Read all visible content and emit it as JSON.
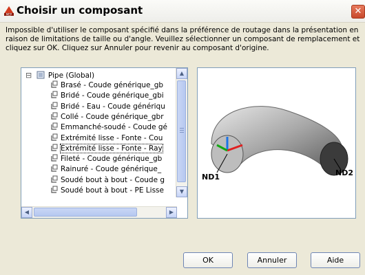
{
  "dialog": {
    "title": "Choisir un composant",
    "close_glyph": "✕",
    "message": "Impossible d'utiliser le composant spécifié dans la préférence de routage dans la présentation en raison de limitations de taille ou d'angle. Veuillez sélectionner un composant de remplacement et cliquez sur OK. Cliquez sur Annuler pour revenir au composant d'origine."
  },
  "tree": {
    "root": {
      "label": "Pipe (Global)",
      "expander": "⊟"
    },
    "items": [
      "Brasé - Coude générique_gb",
      "Bridé - Coude générique_gbi",
      "Bridé - Eau - Coude génériqu",
      "Collé - Coude générique_gbr",
      "Emmanché-soudé - Coude gé",
      "Extrémité lisse - Fonte - Cou",
      "Extrémité lisse - Fonte - Ray",
      "Fileté - Coude générique_gb",
      "Rainuré - Coude générique_",
      "Soudé bout à bout - Coude g",
      "Soudé bout à bout - PE Lisse"
    ],
    "selected_index": 6,
    "scrollbar": {
      "up": "▲",
      "down": "▼",
      "left": "◀",
      "right": "▶"
    }
  },
  "preview": {
    "label_left": "ND1",
    "label_right": "ND2"
  },
  "buttons": {
    "ok": "OK",
    "cancel": "Annuler",
    "help": "Aide"
  },
  "colors": {
    "selection_border": "#000000",
    "link_blue": "#7f9db9",
    "close_red": "#c7492c"
  }
}
